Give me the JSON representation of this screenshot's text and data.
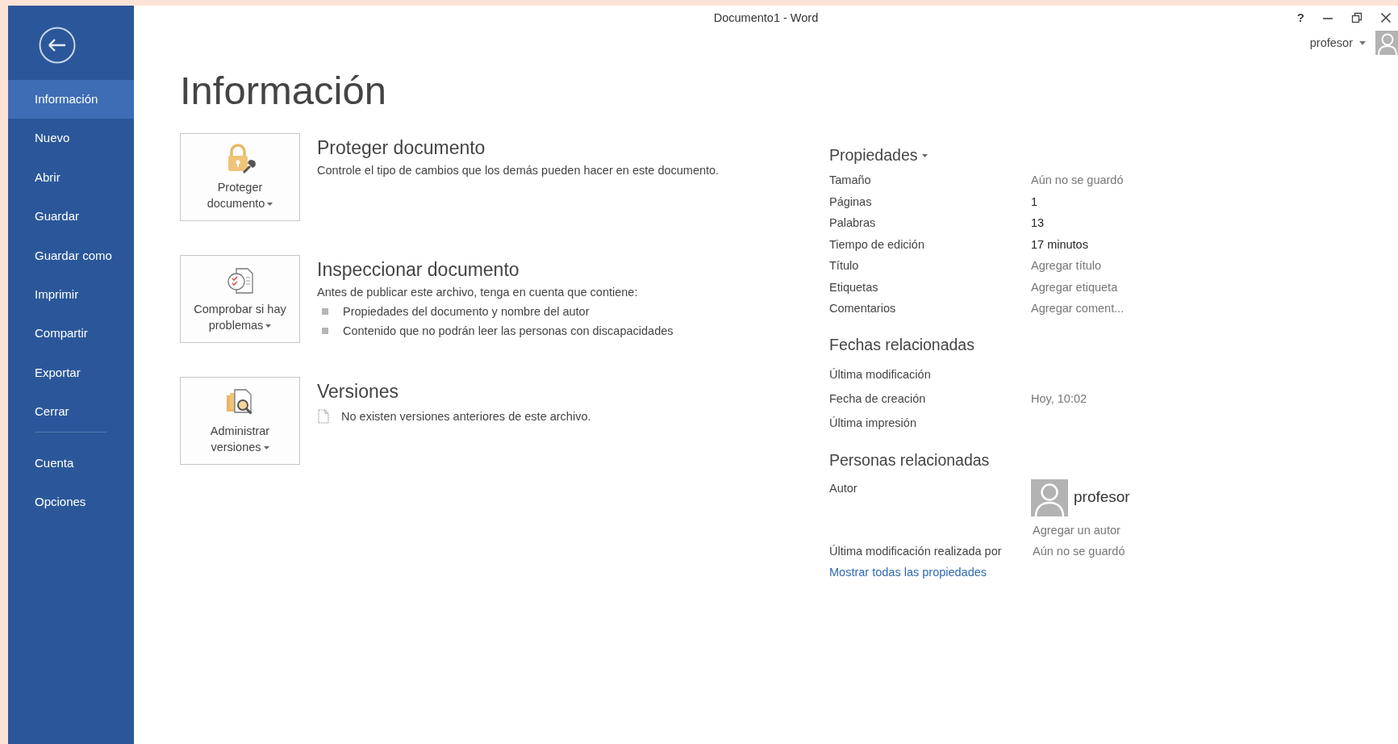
{
  "window": {
    "title": "Documento1 - Word",
    "help": "?",
    "user": "profesor"
  },
  "sidebar": {
    "items": [
      {
        "label": "Información",
        "selected": true
      },
      {
        "label": "Nuevo",
        "selected": false
      },
      {
        "label": "Abrir",
        "selected": false
      },
      {
        "label": "Guardar",
        "selected": false
      },
      {
        "label": "Guardar como",
        "selected": false
      },
      {
        "label": "Imprimir",
        "selected": false
      },
      {
        "label": "Compartir",
        "selected": false
      },
      {
        "label": "Exportar",
        "selected": false
      },
      {
        "label": "Cerrar",
        "selected": false
      }
    ],
    "bottom_items": [
      {
        "label": "Cuenta",
        "selected": false
      },
      {
        "label": "Opciones",
        "selected": false
      }
    ]
  },
  "page_title": "Información",
  "sections": [
    {
      "kind": "protect",
      "button": [
        "Proteger",
        "documento"
      ],
      "heading": "Proteger documento",
      "text": "Controle el tipo de cambios que los demás pueden hacer en este documento."
    },
    {
      "kind": "inspect",
      "button": [
        "Comprobar si hay",
        "problemas"
      ],
      "heading": "Inspeccionar documento",
      "text": "Antes de publicar este archivo, tenga en cuenta que contiene:",
      "bullets": [
        "Propiedades del documento y nombre del autor",
        "Contenido que no podrán leer las personas con discapacidades"
      ]
    },
    {
      "kind": "versions",
      "button": [
        "Administrar",
        "versiones"
      ],
      "heading": "Versiones",
      "note": "No existen versiones anteriores de este archivo."
    }
  ],
  "properties": {
    "heading": "Propiedades",
    "rows": [
      {
        "label": "Tamaño",
        "value": "Aún no se guardó",
        "kind": "hint"
      },
      {
        "label": "Páginas",
        "value": "1",
        "kind": "value"
      },
      {
        "label": "Palabras",
        "value": "13",
        "kind": "value"
      },
      {
        "label": "Tiempo de edición",
        "value": "17 minutos",
        "kind": "value"
      },
      {
        "label": "Título",
        "value": "Agregar título",
        "kind": "hint"
      },
      {
        "label": "Etiquetas",
        "value": "Agregar etiqueta",
        "kind": "hint"
      },
      {
        "label": "Comentarios",
        "value": "Agregar coment...",
        "kind": "hint"
      }
    ]
  },
  "dates": {
    "heading": "Fechas relacionadas",
    "rows": [
      {
        "label": "Última modificación"
      },
      {
        "label": "Fecha de creación",
        "value": "Hoy, 10:02"
      },
      {
        "label": "Última impresión"
      }
    ]
  },
  "people": {
    "heading": "Personas relacionadas",
    "author_label": "Autor",
    "author": "profesor",
    "add_author": "Agregar un autor",
    "modified_by_label": "Última modificación realizada por",
    "modified_by": "Aún no se guardó"
  },
  "show_all_link": "Mostrar todas las propiedades"
}
